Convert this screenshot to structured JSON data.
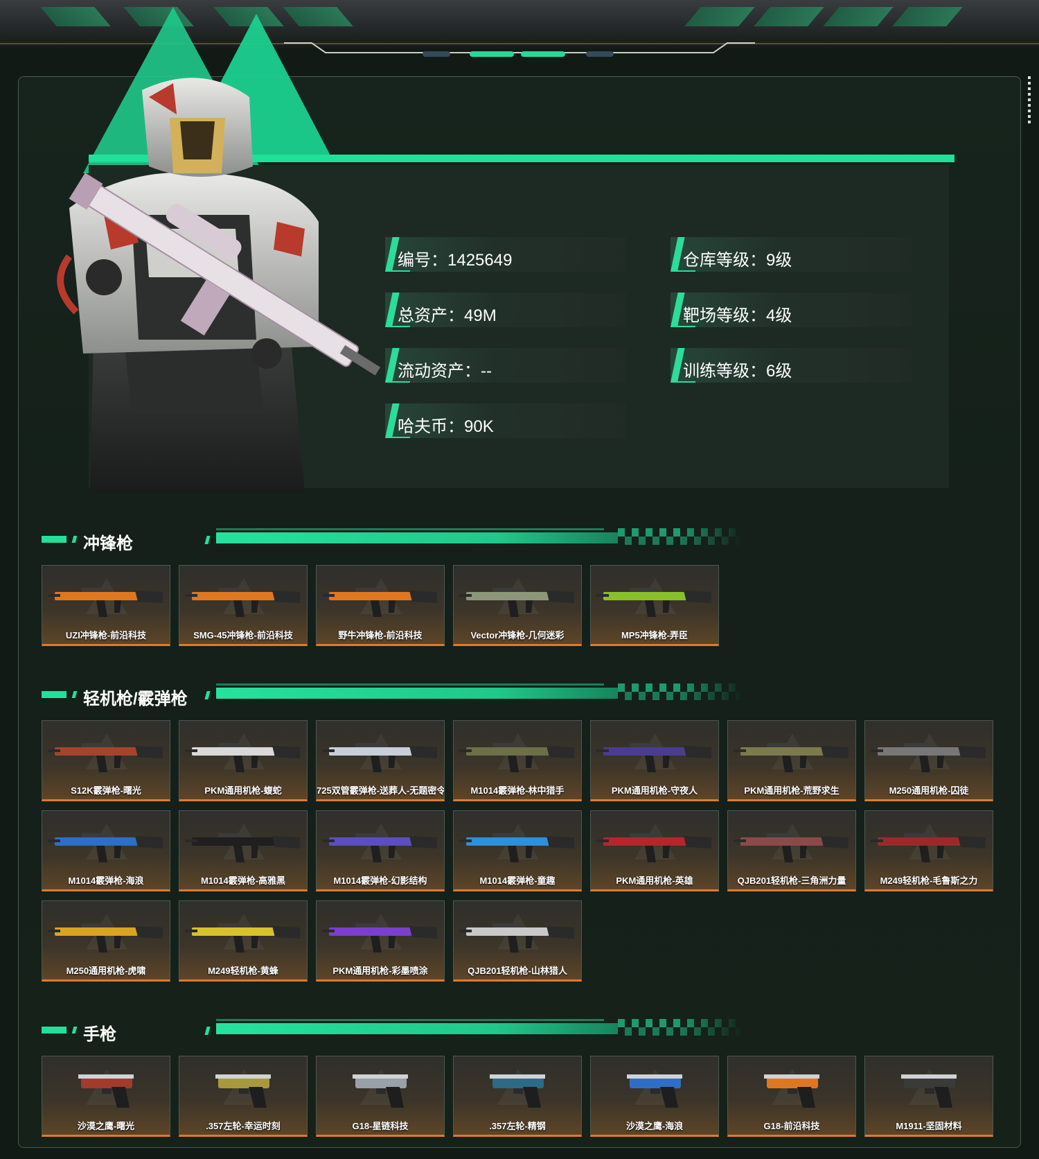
{
  "profile": {
    "stats": [
      {
        "label": "编号：1425649"
      },
      {
        "label": "仓库等级：9级"
      },
      {
        "label": "总资产：49M"
      },
      {
        "label": "靶场等级：4级"
      },
      {
        "label": "流动资产：--"
      },
      {
        "label": "训练等级：6级"
      },
      {
        "label": "哈夫币：90K"
      }
    ]
  },
  "sections": [
    {
      "title": "冲锋枪",
      "items": [
        {
          "name": "UZI冲锋枪-前沿科技",
          "color": "#e0771f"
        },
        {
          "name": "SMG-45冲锋枪-前沿科技",
          "color": "#e0771f"
        },
        {
          "name": "野牛冲锋枪-前沿科技",
          "color": "#e0771f"
        },
        {
          "name": "Vector冲锋枪-几何迷彩",
          "color": "#8c977a"
        },
        {
          "name": "MP5冲锋枪-弄臣",
          "color": "#88c02a"
        }
      ]
    },
    {
      "title": "轻机枪/霰弹枪",
      "items": [
        {
          "name": "S12K霰弹枪-曙光",
          "color": "#a3452c"
        },
        {
          "name": "PKM通用机枪-蝮蛇",
          "color": "#d9d9d9"
        },
        {
          "name": "725双管霰弹枪-送葬人-无题密令",
          "color": "#c7cfdb"
        },
        {
          "name": "M1014霰弹枪-林中猎手",
          "color": "#6c6f48"
        },
        {
          "name": "PKM通用机枪-守夜人",
          "color": "#4a3d8f"
        },
        {
          "name": "PKM通用机枪-荒野求生",
          "color": "#7b7a4e"
        },
        {
          "name": "M250通用机枪-囚徒",
          "color": "#777777"
        },
        {
          "name": "M1014霰弹枪-海浪",
          "color": "#2d6fc7"
        },
        {
          "name": "M1014霰弹枪-高雅黑",
          "color": "#1f1f1f"
        },
        {
          "name": "M1014霰弹枪-幻影结构",
          "color": "#5b4fc0"
        },
        {
          "name": "M1014霰弹枪-童趣",
          "color": "#2f8fd8"
        },
        {
          "name": "PKM通用机枪-英雄",
          "color": "#b3262b"
        },
        {
          "name": "QJB201轻机枪-三角洲力量",
          "color": "#8a4a4a"
        },
        {
          "name": "M249轻机枪-毛鲁斯之力",
          "color": "#9a2a2a"
        },
        {
          "name": "M250通用机枪-虎啸",
          "color": "#d9a520"
        },
        {
          "name": "M249轻机枪-黄蜂",
          "color": "#d8c22a"
        },
        {
          "name": "PKM通用机枪-彩墨喷涂",
          "color": "#7a3fd0"
        },
        {
          "name": "QJB201轻机枪-山林猎人",
          "color": "#c9c9c9"
        }
      ]
    },
    {
      "title": "手枪",
      "items": [
        {
          "name": "沙漠之鹰-曙光",
          "color": "#a33a2c"
        },
        {
          "name": ".357左轮-幸运时刻",
          "color": "#a89a3a"
        },
        {
          "name": "G18-星链科技",
          "color": "#9aa0a8"
        },
        {
          "name": ".357左轮-精钢",
          "color": "#2c6a86"
        },
        {
          "name": "沙漠之鹰-海浪",
          "color": "#2d6fc7"
        },
        {
          "name": "G18-前沿科技",
          "color": "#e0771f"
        },
        {
          "name": "M1911-坚固材料",
          "color": "#3a3a38"
        }
      ]
    }
  ]
}
